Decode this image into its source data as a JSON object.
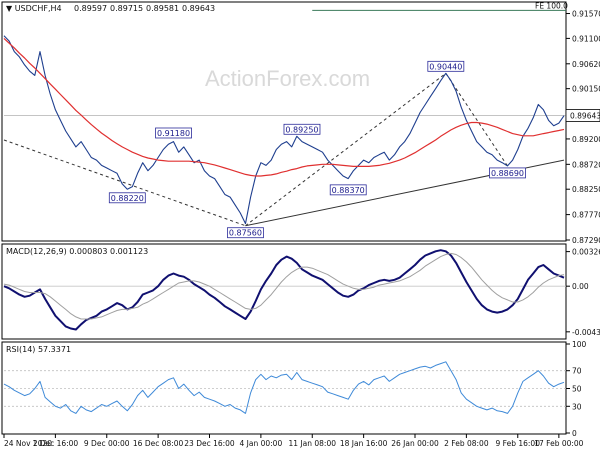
{
  "chart_data": {
    "type": "line",
    "watermark": "ActionForex.com",
    "price_panel": {
      "header": {
        "symbol": "USDCHF,H4",
        "ohlc": [
          "0.89597",
          "0.89715",
          "0.89581",
          "0.89643"
        ]
      },
      "y_ticks": [
        "0.91570",
        "0.91100",
        "0.90620",
        "0.90150",
        "0.89670",
        "0.89200",
        "0.88720",
        "0.88250",
        "0.87770",
        "0.87290"
      ],
      "ylim": [
        0.8729,
        0.9175
      ],
      "current_price": "0.89643",
      "fe_label": "FE 100.0",
      "fe_level": 0.9163,
      "swing_labels": [
        {
          "text": "0.91180",
          "t": 33,
          "v": 0.8918
        },
        {
          "text": "0.88220",
          "t": 24,
          "v": 0.8822
        },
        {
          "text": "0.87560",
          "t": 47,
          "v": 0.8756
        },
        {
          "text": "0.89250",
          "t": 58,
          "v": 0.8925
        },
        {
          "text": "0.88370",
          "t": 67,
          "v": 0.8837
        },
        {
          "text": "0.90440",
          "t": 86,
          "v": 0.9044
        },
        {
          "text": "0.88690",
          "t": 98,
          "v": 0.8869
        }
      ],
      "trend_lines": [
        {
          "from": [
            0,
            0.8918
          ],
          "to": [
            47,
            0.8756
          ],
          "style": "dashed"
        },
        {
          "from": [
            47,
            0.8756
          ],
          "to": [
            86,
            0.9044
          ],
          "style": "dashed"
        },
        {
          "from": [
            86,
            0.9044
          ],
          "to": [
            98,
            0.8869
          ],
          "style": "dashed"
        },
        {
          "from": [
            47,
            0.8756
          ],
          "to": [
            109,
            0.888
          ],
          "style": "solid"
        }
      ],
      "series": [
        {
          "role": "price",
          "color": "#1f3f8f",
          "values": [
            0.9115,
            0.9105,
            0.9085,
            0.9075,
            0.906,
            0.9048,
            0.904,
            0.9085,
            0.904,
            0.9005,
            0.8975,
            0.8955,
            0.8935,
            0.892,
            0.8905,
            0.8915,
            0.89,
            0.8885,
            0.888,
            0.887,
            0.8865,
            0.886,
            0.8855,
            0.8835,
            0.8825,
            0.883,
            0.8855,
            0.8875,
            0.886,
            0.887,
            0.8885,
            0.89,
            0.891,
            0.8915,
            0.8895,
            0.8905,
            0.889,
            0.8875,
            0.888,
            0.886,
            0.885,
            0.8845,
            0.883,
            0.8815,
            0.881,
            0.8795,
            0.878,
            0.876,
            0.881,
            0.885,
            0.8875,
            0.887,
            0.888,
            0.89,
            0.891,
            0.8915,
            0.8905,
            0.8925,
            0.8915,
            0.891,
            0.8905,
            0.89,
            0.8895,
            0.888,
            0.887,
            0.886,
            0.885,
            0.8845,
            0.886,
            0.887,
            0.888,
            0.8875,
            0.8885,
            0.889,
            0.8895,
            0.888,
            0.889,
            0.8905,
            0.8915,
            0.893,
            0.895,
            0.897,
            0.8985,
            0.9,
            0.9015,
            0.903,
            0.9044,
            0.903,
            0.901,
            0.898,
            0.8955,
            0.8935,
            0.8915,
            0.8905,
            0.8895,
            0.889,
            0.888,
            0.8875,
            0.8869,
            0.888,
            0.89,
            0.8925,
            0.894,
            0.896,
            0.8985,
            0.8975,
            0.8955,
            0.8945,
            0.895,
            0.8964
          ]
        },
        {
          "role": "sma",
          "color": "#e03030",
          "values": [
            0.911,
            0.9101,
            0.9092,
            0.9082,
            0.9073,
            0.9063,
            0.9054,
            0.9044,
            0.9034,
            0.9024,
            0.9014,
            0.9004,
            0.8994,
            0.8984,
            0.8974,
            0.8965,
            0.8956,
            0.8947,
            0.8939,
            0.8931,
            0.8924,
            0.8917,
            0.8911,
            0.8905,
            0.89,
            0.8895,
            0.8891,
            0.8887,
            0.8884,
            0.8882,
            0.888,
            0.8879,
            0.8878,
            0.8878,
            0.8878,
            0.8878,
            0.8878,
            0.8877,
            0.8876,
            0.8875,
            0.8873,
            0.8871,
            0.8868,
            0.8865,
            0.8862,
            0.8859,
            0.8856,
            0.8853,
            0.8851,
            0.885,
            0.885,
            0.8851,
            0.8852,
            0.8854,
            0.8857,
            0.8859,
            0.8862,
            0.8864,
            0.8867,
            0.8869,
            0.887,
            0.8871,
            0.8872,
            0.8872,
            0.8872,
            0.8871,
            0.887,
            0.8869,
            0.8868,
            0.8868,
            0.8868,
            0.8868,
            0.8869,
            0.887,
            0.8872,
            0.8874,
            0.8877,
            0.888,
            0.8884,
            0.8889,
            0.8894,
            0.89,
            0.8906,
            0.8912,
            0.8918,
            0.8925,
            0.8931,
            0.8937,
            0.8942,
            0.8946,
            0.8949,
            0.8951,
            0.8951,
            0.895,
            0.8948,
            0.8945,
            0.8942,
            0.8938,
            0.8934,
            0.893,
            0.8928,
            0.8926,
            0.8926,
            0.8926,
            0.8928,
            0.893,
            0.8932,
            0.8934,
            0.8936,
            0.8938
          ]
        }
      ]
    },
    "macd_panel": {
      "label": "MACD(12,26,9) 0.000803 0.001123",
      "y_ticks": [
        "0.003269",
        "0.00",
        "-0.004316"
      ],
      "ylim": [
        -0.0049,
        0.0038
      ],
      "series": [
        {
          "role": "macd",
          "color": "#101070",
          "values": [
            0.0,
            -0.0002,
            -0.0005,
            -0.0008,
            -0.001,
            -0.0009,
            -0.0006,
            -0.0003,
            -0.0012,
            -0.002,
            -0.0028,
            -0.0033,
            -0.0038,
            -0.004,
            -0.0041,
            -0.0036,
            -0.0032,
            -0.003,
            -0.0028,
            -0.0024,
            -0.0022,
            -0.0019,
            -0.0016,
            -0.0018,
            -0.0022,
            -0.002,
            -0.0015,
            -0.0008,
            -0.0006,
            -0.0004,
            0.0,
            0.0006,
            0.001,
            0.0012,
            0.001,
            0.0009,
            0.0006,
            0.0002,
            -0.0001,
            -0.0004,
            -0.0008,
            -0.0011,
            -0.0015,
            -0.0019,
            -0.0022,
            -0.0025,
            -0.0028,
            -0.0031,
            -0.0024,
            -0.0014,
            -0.0003,
            0.0005,
            0.0012,
            0.002,
            0.0025,
            0.0028,
            0.0026,
            0.0022,
            0.0016,
            0.0013,
            0.001,
            0.0008,
            0.0006,
            0.0002,
            -0.0002,
            -0.0006,
            -0.0009,
            -0.001,
            -0.0008,
            -0.0004,
            -0.0002,
            0.0001,
            0.0003,
            0.0005,
            0.0006,
            0.0005,
            0.0006,
            0.0008,
            0.0012,
            0.0016,
            0.002,
            0.0025,
            0.0029,
            0.0031,
            0.0033,
            0.0034,
            0.0033,
            0.0029,
            0.0022,
            0.0013,
            0.0004,
            -0.0004,
            -0.0012,
            -0.0018,
            -0.0022,
            -0.0024,
            -0.0025,
            -0.0024,
            -0.0022,
            -0.0018,
            -0.0012,
            -0.0003,
            0.0006,
            0.0012,
            0.0018,
            0.002,
            0.0016,
            0.0012,
            0.001,
            0.0008
          ]
        },
        {
          "role": "signal",
          "color": "#a0a0a0",
          "values": [
            0.0002,
            0.0001,
            -0.0001,
            -0.0003,
            -0.0005,
            -0.0006,
            -0.0006,
            -0.0006,
            -0.0007,
            -0.001,
            -0.0014,
            -0.0018,
            -0.0022,
            -0.0026,
            -0.0029,
            -0.0031,
            -0.0031,
            -0.0031,
            -0.003,
            -0.0029,
            -0.0027,
            -0.0025,
            -0.0023,
            -0.0022,
            -0.0022,
            -0.0021,
            -0.002,
            -0.0017,
            -0.0015,
            -0.0012,
            -0.0009,
            -0.0006,
            -0.0003,
            0.0,
            0.0003,
            0.0004,
            0.0005,
            0.0005,
            0.0004,
            0.0002,
            0.0,
            -0.0003,
            -0.0006,
            -0.0009,
            -0.0012,
            -0.0015,
            -0.0018,
            -0.0021,
            -0.0022,
            -0.0021,
            -0.0018,
            -0.0013,
            -0.0008,
            -0.0002,
            0.0004,
            0.0009,
            0.0013,
            0.0016,
            0.0018,
            0.0018,
            0.0017,
            0.0015,
            0.0013,
            0.0011,
            0.0008,
            0.0005,
            0.0002,
            0.0,
            -0.0002,
            -0.0003,
            -0.0003,
            -0.0002,
            -0.0001,
            0.0001,
            0.0002,
            0.0003,
            0.0004,
            0.0005,
            0.0007,
            0.0009,
            0.0012,
            0.0015,
            0.0019,
            0.0022,
            0.0025,
            0.0028,
            0.003,
            0.0031,
            0.003,
            0.0027,
            0.0023,
            0.0018,
            0.0012,
            0.0006,
            0.0001,
            -0.0004,
            -0.0008,
            -0.0011,
            -0.0013,
            -0.0015,
            -0.0015,
            -0.0013,
            -0.001,
            -0.0006,
            -0.0001,
            0.0003,
            0.0006,
            0.0008,
            0.001,
            0.0011
          ]
        }
      ]
    },
    "rsi_panel": {
      "label": "RSI(14) 57.3371",
      "y_ticks": [
        "100",
        "70",
        "50",
        "30",
        "0"
      ],
      "ylim": [
        0,
        100
      ],
      "levels": [
        70,
        50,
        30
      ],
      "series": [
        {
          "role": "rsi",
          "color": "#3f8ad8",
          "values": [
            55,
            52,
            48,
            45,
            42,
            44,
            50,
            58,
            40,
            35,
            30,
            28,
            32,
            25,
            22,
            30,
            26,
            24,
            28,
            32,
            30,
            33,
            36,
            30,
            25,
            32,
            42,
            48,
            40,
            46,
            52,
            56,
            60,
            62,
            50,
            55,
            48,
            42,
            46,
            40,
            38,
            36,
            33,
            30,
            32,
            28,
            26,
            22,
            45,
            60,
            66,
            60,
            64,
            62,
            65,
            66,
            60,
            68,
            60,
            58,
            56,
            54,
            52,
            46,
            44,
            42,
            40,
            38,
            48,
            55,
            58,
            54,
            60,
            62,
            64,
            58,
            62,
            66,
            68,
            70,
            72,
            74,
            75,
            73,
            76,
            78,
            80,
            70,
            60,
            45,
            38,
            34,
            30,
            28,
            26,
            28,
            25,
            24,
            22,
            30,
            45,
            58,
            62,
            66,
            70,
            64,
            56,
            52,
            55,
            57
          ]
        }
      ]
    },
    "x_tick_labels": [
      "24 Nov 2020",
      "1 Dec 16:00",
      "9 Dec 00:00",
      "16 Dec 08:00",
      "23 Dec 16:00",
      "4 Jan 00:00",
      "11 Jan 08:00",
      "18 Jan 16:00",
      "26 Jan 00:00",
      "2 Feb 08:00",
      "9 Feb 16:00",
      "17 Feb 00:00"
    ],
    "x_tick_positions": [
      0,
      10,
      20,
      30,
      40,
      50,
      60,
      70,
      80,
      90,
      100,
      108
    ]
  }
}
